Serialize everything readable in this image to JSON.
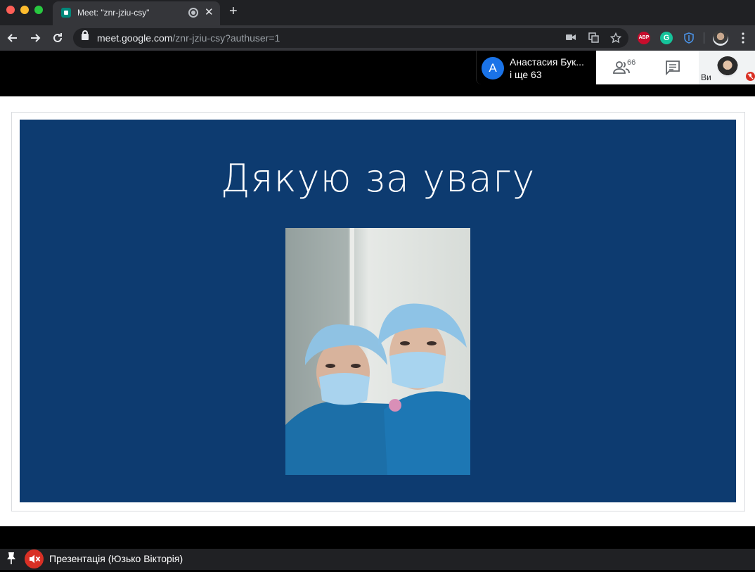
{
  "browser": {
    "tab_title": "Meet: \"znr-jziu-csy\"",
    "close_glyph": "✕",
    "new_tab_glyph": "+",
    "url_host": "meet.google.com",
    "url_path": "/znr-jziu-csy?authuser=1",
    "extensions": {
      "abp": "ABP",
      "grammarly": "G"
    }
  },
  "meet": {
    "participant_name": "Анастасия Бук...",
    "participant_initial": "A",
    "participant_more": "і ще 63",
    "people_count": "66",
    "self_label": "Ви"
  },
  "slide": {
    "title": "Дякую за увагу"
  },
  "bottom": {
    "presentation_label": "Презентація (Юзько Вікторія)"
  },
  "colors": {
    "slide_bg": "#0d3b70",
    "mute_red": "#d93025",
    "meet_avatar_blue": "#1a73e8"
  }
}
